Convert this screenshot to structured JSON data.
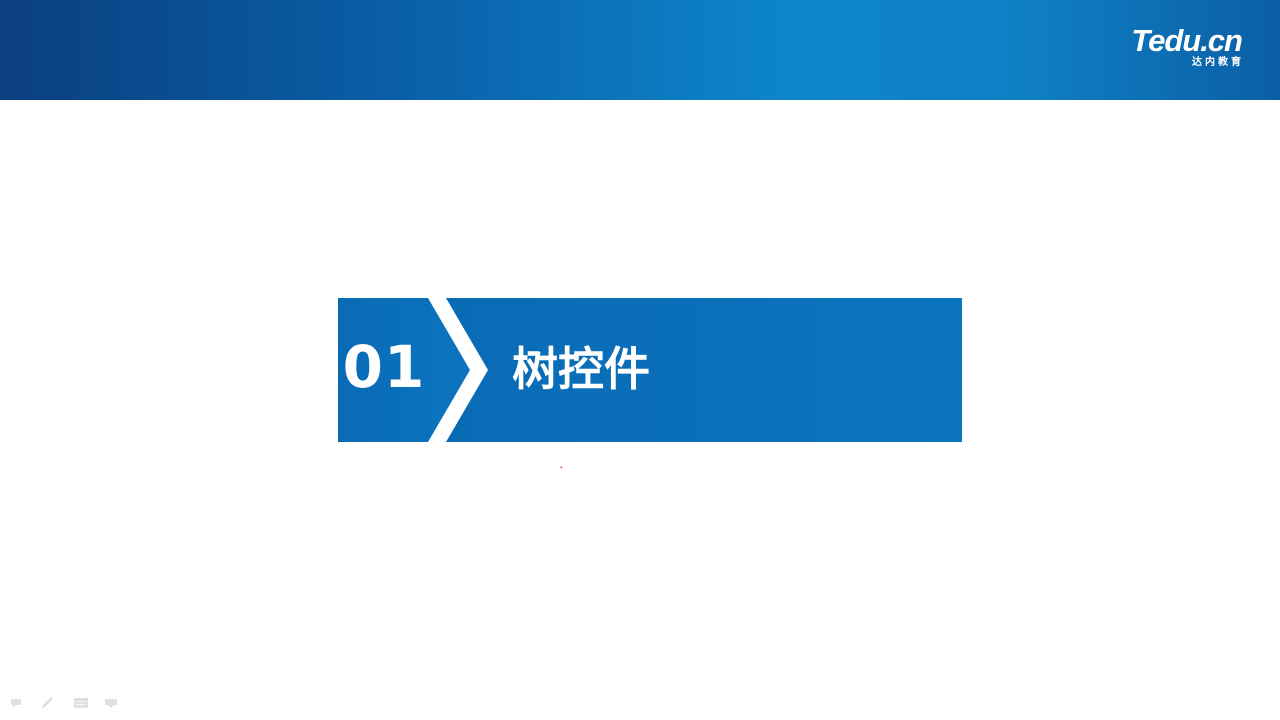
{
  "header": {
    "logo_text": "Tedu.cn",
    "logo_subtext": "达内教育"
  },
  "section": {
    "number": "01",
    "title": "树控件"
  },
  "colors": {
    "header_dark": "#0b3f7f",
    "header_light": "#0d86cc",
    "banner_blue": "#0a6eb8",
    "text_white": "#ffffff"
  },
  "slideshow_toolbar": {
    "buttons": [
      "previous-icon",
      "pen-icon",
      "menu-icon",
      "next-icon"
    ]
  }
}
